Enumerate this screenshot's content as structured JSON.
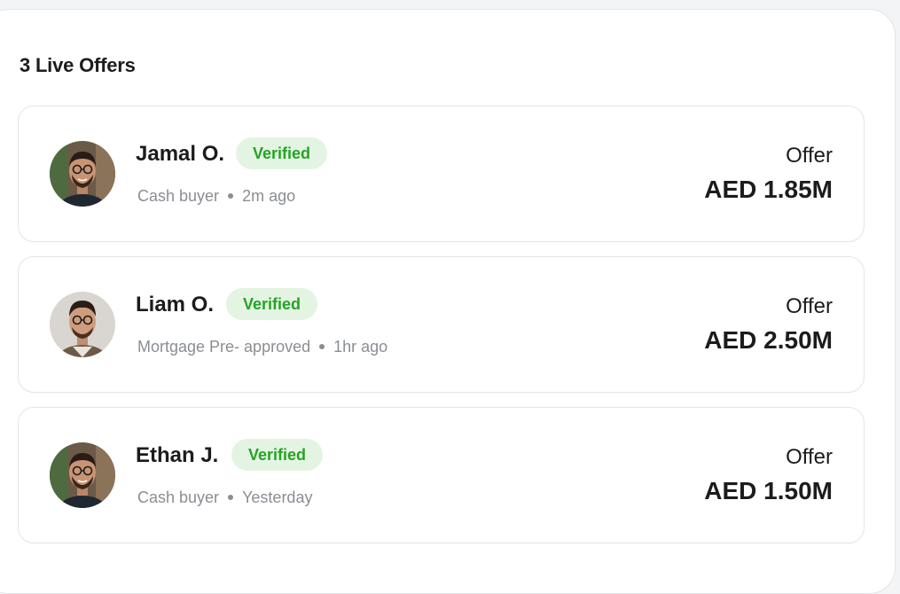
{
  "panel": {
    "title": "3 Live Offers"
  },
  "offers": [
    {
      "name": "Jamal O.",
      "badge": "Verified",
      "buyer_type": "Cash buyer",
      "time": "2m ago",
      "offer_label": "Offer",
      "amount": "AED 1.85M",
      "avatar_icon": "person-avatar"
    },
    {
      "name": "Liam O.",
      "badge": "Verified",
      "buyer_type": "Mortgage Pre- approved",
      "time": "1hr ago",
      "offer_label": "Offer",
      "amount": "AED 2.50M",
      "avatar_icon": "person-avatar"
    },
    {
      "name": "Ethan J.",
      "badge": "Verified",
      "buyer_type": "Cash buyer",
      "time": "Yesterday",
      "offer_label": "Offer",
      "amount": "AED 1.50M",
      "avatar_icon": "person-avatar"
    }
  ],
  "colors": {
    "badge_bg": "#e3f5e2",
    "badge_text": "#26a325",
    "text_primary": "#1c1c1c",
    "text_muted": "#8a8e93",
    "card_border": "#e2e4e7"
  }
}
